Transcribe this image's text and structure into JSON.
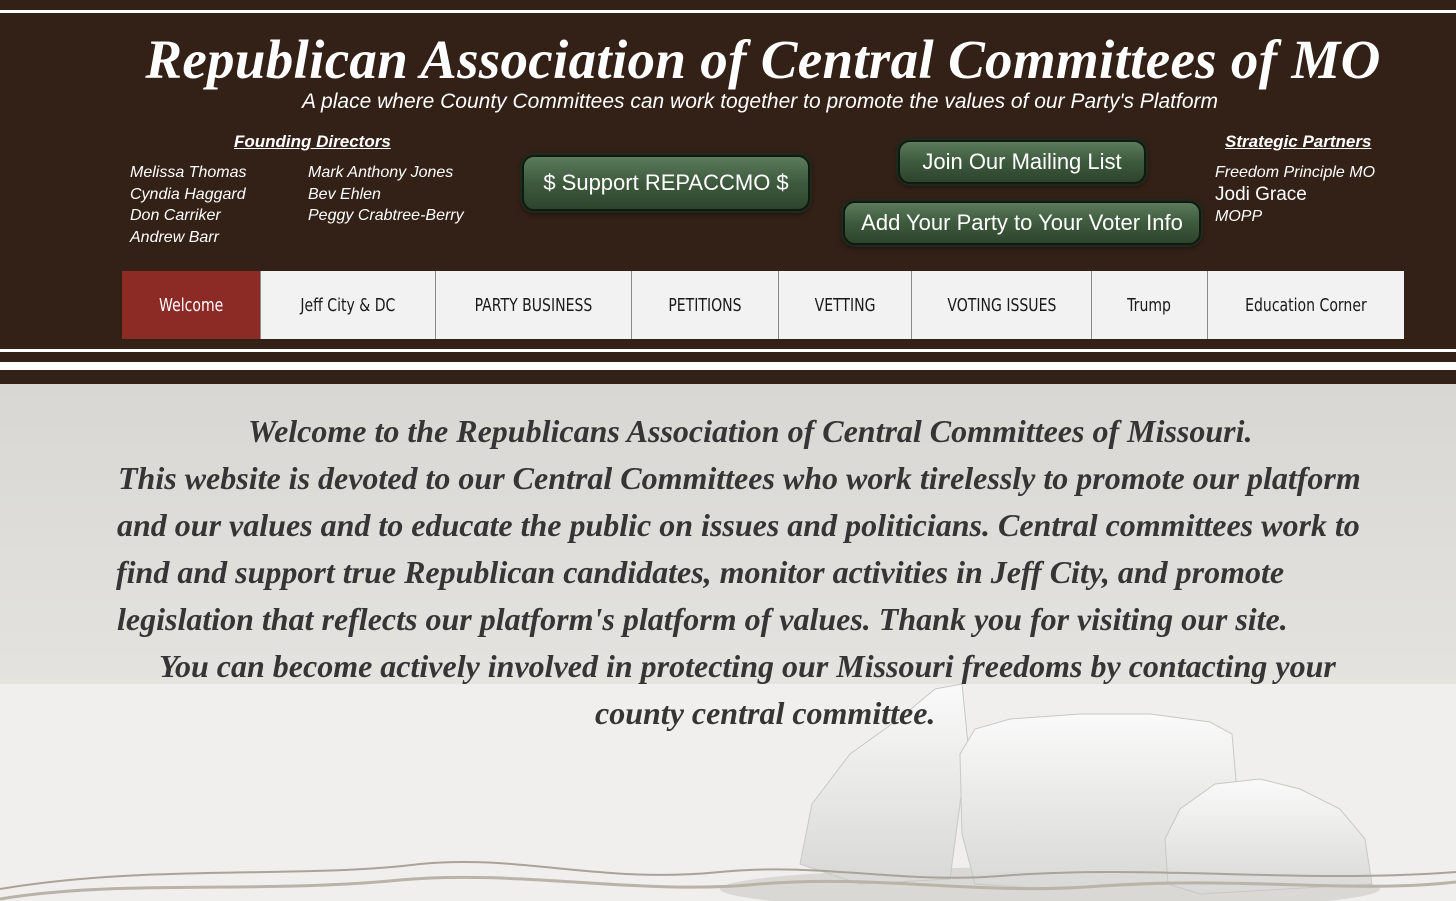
{
  "header": {
    "title": "Republican Association of Central Committees of MO",
    "tagline": "A place where County Committees can work together to promote the values of our Party's Platform",
    "founding_directors": {
      "heading": "Founding Directors",
      "col1": [
        "Melissa Thomas",
        "Cyndia Haggard",
        "Don Carriker",
        "Andrew Barr"
      ],
      "col2": [
        "Mark Anthony Jones",
        "Bev Ehlen",
        "Peggy Crabtree-Berry"
      ]
    },
    "strategic_partners": {
      "heading": "Strategic Partners",
      "items": [
        "Freedom Principle MO",
        "Jodi Grace",
        "MOPP"
      ]
    },
    "buttons": {
      "support": "$ Support REPACCMO $",
      "mailing_list": "Join Our Mailing List",
      "add_party": "Add Your Party to Your Voter Info"
    }
  },
  "nav": {
    "items": [
      "Welcome",
      "Jeff City & DC",
      "PARTY BUSINESS",
      "PETITIONS",
      "VETTING",
      "VOTING ISSUES",
      "Trump",
      "Education Corner"
    ],
    "active": "Welcome"
  },
  "main": {
    "lines": [
      "Welcome to the Republicans Association of Central Committees of Missouri.",
      "This website is devoted to our Central Committees who work tirelessly to promote our platform",
      "and our values and to educate the public on issues and politicians. Central committees work to",
      "find and support true Republican candidates, monitor activities in Jeff City, and promote",
      "legislation that reflects our platform's platform of values. Thank you for visiting our site.",
      "You can become actively involved in protecting our Missouri freedoms by contacting your",
      "county central committee."
    ]
  },
  "colors": {
    "header_bg": "#332016",
    "nav_active": "#8c2a26",
    "button_green": "#3e5a3e"
  }
}
